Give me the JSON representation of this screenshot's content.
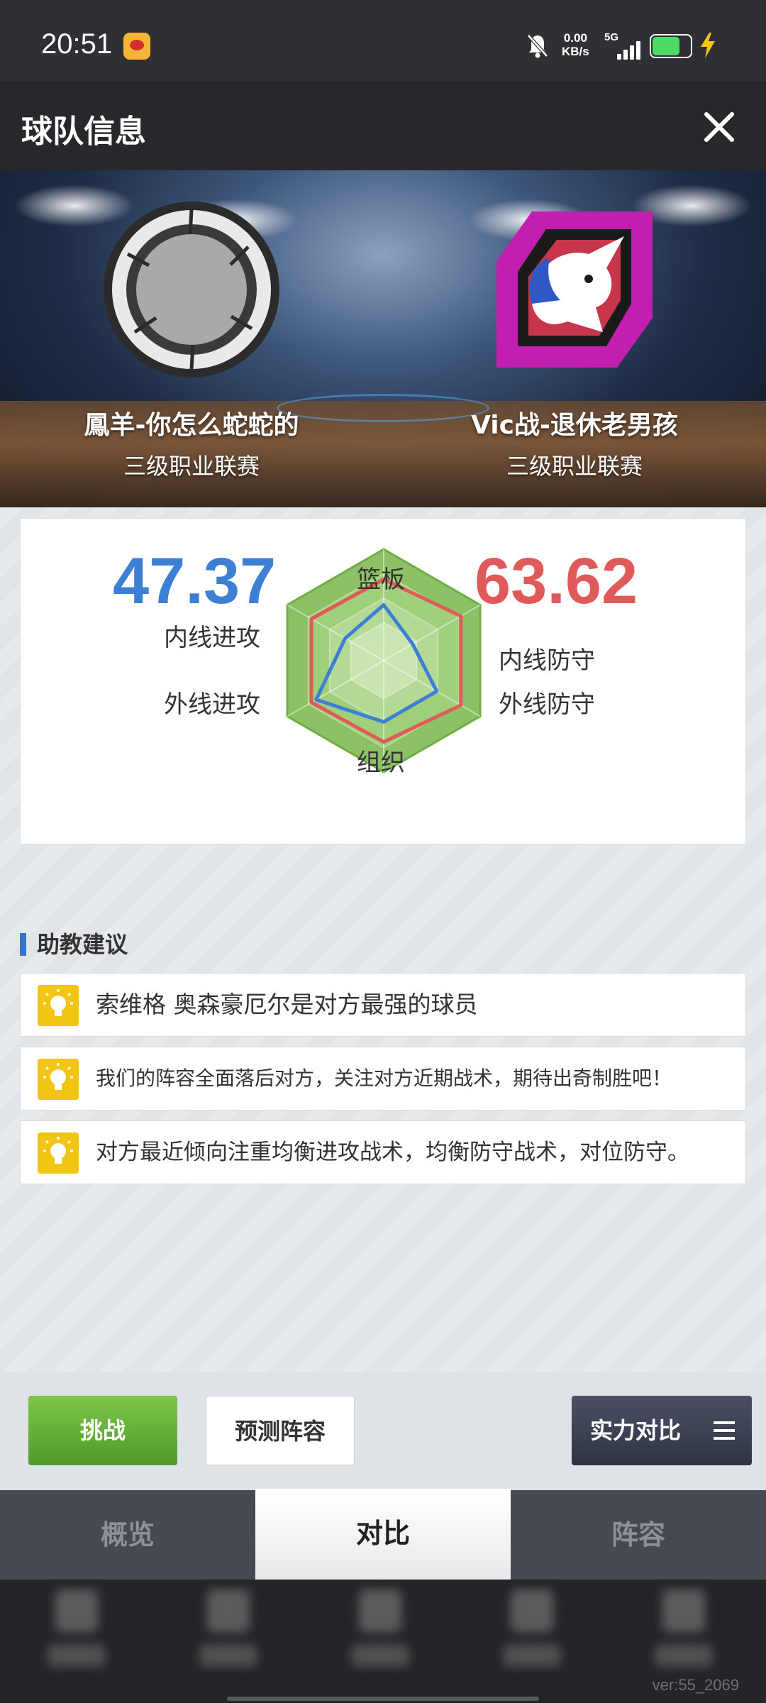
{
  "status_bar": {
    "time": "20:51",
    "net_speed_value": "0.00",
    "net_speed_unit": "KB/s",
    "network": "5G",
    "app_icon": "weibo-icon"
  },
  "header": {
    "title": "球队信息",
    "close_icon": "close-icon"
  },
  "teams": {
    "left": {
      "name": "鳳羊-你怎么蛇蛇的",
      "league": "三级职业联赛",
      "score": "47.37",
      "color": "#3e7fd6"
    },
    "right": {
      "name": "Vic战-退休老男孩",
      "league": "三级职业联赛",
      "score": "63.62",
      "color": "#e05a5a"
    }
  },
  "radar": {
    "axes": [
      "篮板",
      "内线防守",
      "外线防守",
      "组织",
      "外线进攻",
      "内线进攻"
    ],
    "left_values": [
      0.5,
      0.3,
      0.55,
      0.55,
      0.7,
      0.4
    ],
    "right_values": [
      0.73,
      0.8,
      0.8,
      0.73,
      0.75,
      0.75
    ],
    "fill_color": "#8cc265"
  },
  "advice": {
    "title": "助教建议",
    "tips": [
      "索维格 奥森豪厄尔是对方最强的球员",
      "我们的阵容全面落后对方，关注对方近期战术，期待出奇制胜吧！",
      "对方最近倾向注重均衡进攻战术，均衡防守战术，对位防守。"
    ]
  },
  "actions": {
    "challenge": "挑战",
    "predict": "预测阵容",
    "strength": "实力对比"
  },
  "tabs": [
    "概览",
    "对比",
    "阵容"
  ],
  "active_tab": 1,
  "version": "ver:55_2069"
}
